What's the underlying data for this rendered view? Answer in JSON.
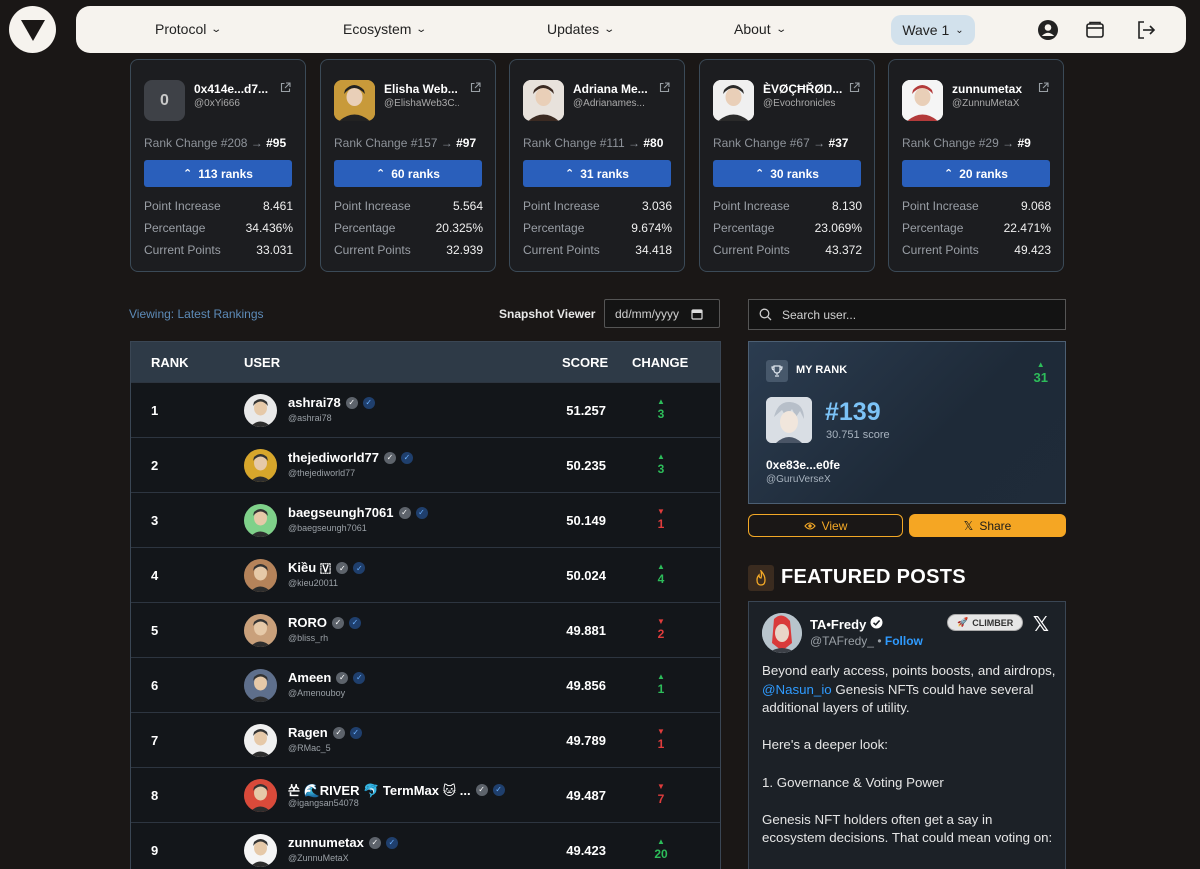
{
  "nav": {
    "items": [
      {
        "label": "Protocol"
      },
      {
        "label": "Ecosystem"
      },
      {
        "label": "Updates"
      },
      {
        "label": "About"
      }
    ],
    "wave_label": "Wave 1",
    "icons": [
      "user-circle-icon",
      "wallet-icon",
      "logout-icon"
    ]
  },
  "movers": [
    {
      "avatar_text": "0",
      "name": "0x414e...d7...",
      "handle": "@0xYi666",
      "from": "#208",
      "to": "#95",
      "ranks": "113 ranks",
      "point_increase": "8.461",
      "percentage": "34.436%",
      "current_points": "33.031"
    },
    {
      "avatar_text": "",
      "name": "Elisha Web...",
      "handle": "@ElishaWeb3C...",
      "from": "#157",
      "to": "#97",
      "ranks": "60 ranks",
      "point_increase": "5.564",
      "percentage": "20.325%",
      "current_points": "32.939"
    },
    {
      "avatar_text": "",
      "name": "Adriana Me...",
      "handle": "@Adrianames...",
      "from": "#111",
      "to": "#80",
      "ranks": "31 ranks",
      "point_increase": "3.036",
      "percentage": "9.674%",
      "current_points": "34.418"
    },
    {
      "avatar_text": "",
      "name": "ÈVØÇĦŘØŊ...",
      "handle": "@Evochronicles",
      "from": "#67",
      "to": "#37",
      "ranks": "30 ranks",
      "point_increase": "8.130",
      "percentage": "23.069%",
      "current_points": "43.372"
    },
    {
      "avatar_text": "",
      "name": "zunnumetax",
      "handle": "@ZunnuMetaX",
      "from": "#29",
      "to": "#9",
      "ranks": "20 ranks",
      "point_increase": "9.068",
      "percentage": "22.471%",
      "current_points": "49.423"
    }
  ],
  "labels": {
    "rank_change": "Rank Change",
    "arrow": "→",
    "point_increase": "Point Increase",
    "percentage": "Percentage",
    "current_points": "Current Points"
  },
  "leaderboard": {
    "viewing": "Viewing: Latest Rankings",
    "snapshot_label": "Snapshot Viewer",
    "date_placeholder": "dd/mm/yyyy",
    "headers": {
      "rank": "RANK",
      "user": "USER",
      "score": "SCORE",
      "change": "CHANGE"
    },
    "rows": [
      {
        "rank": "1",
        "name": "ashrai78",
        "handle": "@ashrai78",
        "score": "51.257",
        "dir": "up",
        "change": "3"
      },
      {
        "rank": "2",
        "name": "thejediworld77",
        "handle": "@thejediworld77",
        "score": "50.235",
        "dir": "up",
        "change": "3"
      },
      {
        "rank": "3",
        "name": "baegseungh7061",
        "handle": "@baegseungh7061",
        "score": "50.149",
        "dir": "down",
        "change": "1"
      },
      {
        "rank": "4",
        "name": "Kiều 🇻",
        "handle": "@kieu20011",
        "score": "50.024",
        "dir": "up",
        "change": "4"
      },
      {
        "rank": "5",
        "name": "RORO",
        "handle": "@bliss_rh",
        "score": "49.881",
        "dir": "down",
        "change": "2"
      },
      {
        "rank": "6",
        "name": "Ameen",
        "handle": "@Amenouboy",
        "score": "49.856",
        "dir": "up",
        "change": "1"
      },
      {
        "rank": "7",
        "name": "Ragen",
        "handle": "@RMac_5",
        "score": "49.789",
        "dir": "down",
        "change": "1"
      },
      {
        "rank": "8",
        "name": "쏜 🌊RIVER 🐬 TermMax 🐱 ...",
        "handle": "@igangsan54078",
        "score": "49.487",
        "dir": "down",
        "change": "7"
      },
      {
        "rank": "9",
        "name": "zunnumetax",
        "handle": "@ZunnuMetaX",
        "score": "49.423",
        "dir": "up",
        "change": "20"
      }
    ]
  },
  "search": {
    "placeholder": "Search user..."
  },
  "my_rank": {
    "label": "MY RANK",
    "change": "31",
    "rank": "#139",
    "score": "30.751 score",
    "address": "0xe83e...e0fe",
    "handle": "@GuruVerseX"
  },
  "actions": {
    "view": "View",
    "share": "Share"
  },
  "featured": {
    "title": "FEATURED POSTS",
    "post": {
      "author": "TA•Fredy",
      "handle": "@TAFredy_",
      "follow": "Follow",
      "badge": "CLIMBER",
      "para1_pre": "Beyond early access, points boosts, and airdrops, ",
      "para1_mention": "@Nasun_io",
      "para1_post": " Genesis NFTs could have several additional layers of utility.",
      "para2": "Here's a deeper look:",
      "para3": "1. Governance & Voting Power",
      "para4": "Genesis NFT holders often get a say in ecosystem decisions. That could mean voting on:"
    }
  },
  "colors": {
    "accent_blue": "#2a5fbb",
    "accent_orange": "#f5a623",
    "up_green": "#2dbd5a",
    "down_red": "#e03c3c",
    "rank_cyan": "#7cc3f7"
  }
}
